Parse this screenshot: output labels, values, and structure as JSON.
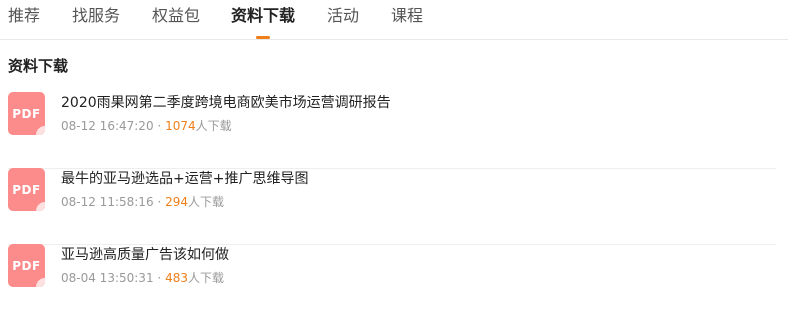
{
  "tabs": [
    {
      "label": "推荐"
    },
    {
      "label": "找服务"
    },
    {
      "label": "权益包"
    },
    {
      "label": "资料下载"
    },
    {
      "label": "活动"
    },
    {
      "label": "课程"
    }
  ],
  "active_tab": "资料下载",
  "accent_color": "#f07f1a",
  "section_title": "资料下载",
  "icon_label": "PDF",
  "separator": "·",
  "download_suffix": "人下载",
  "items": [
    {
      "title": "2020雨果网第二季度跨境电商欧美市场运营调研报告",
      "time": "08-12 16:47:20",
      "count": "1074"
    },
    {
      "title": "最牛的亚马逊选品+运营+推广思维导图",
      "time": "08-12 11:58:16",
      "count": "294"
    },
    {
      "title": "亚马逊高质量广告该如何做",
      "time": "08-04 13:50:31",
      "count": "483"
    }
  ]
}
